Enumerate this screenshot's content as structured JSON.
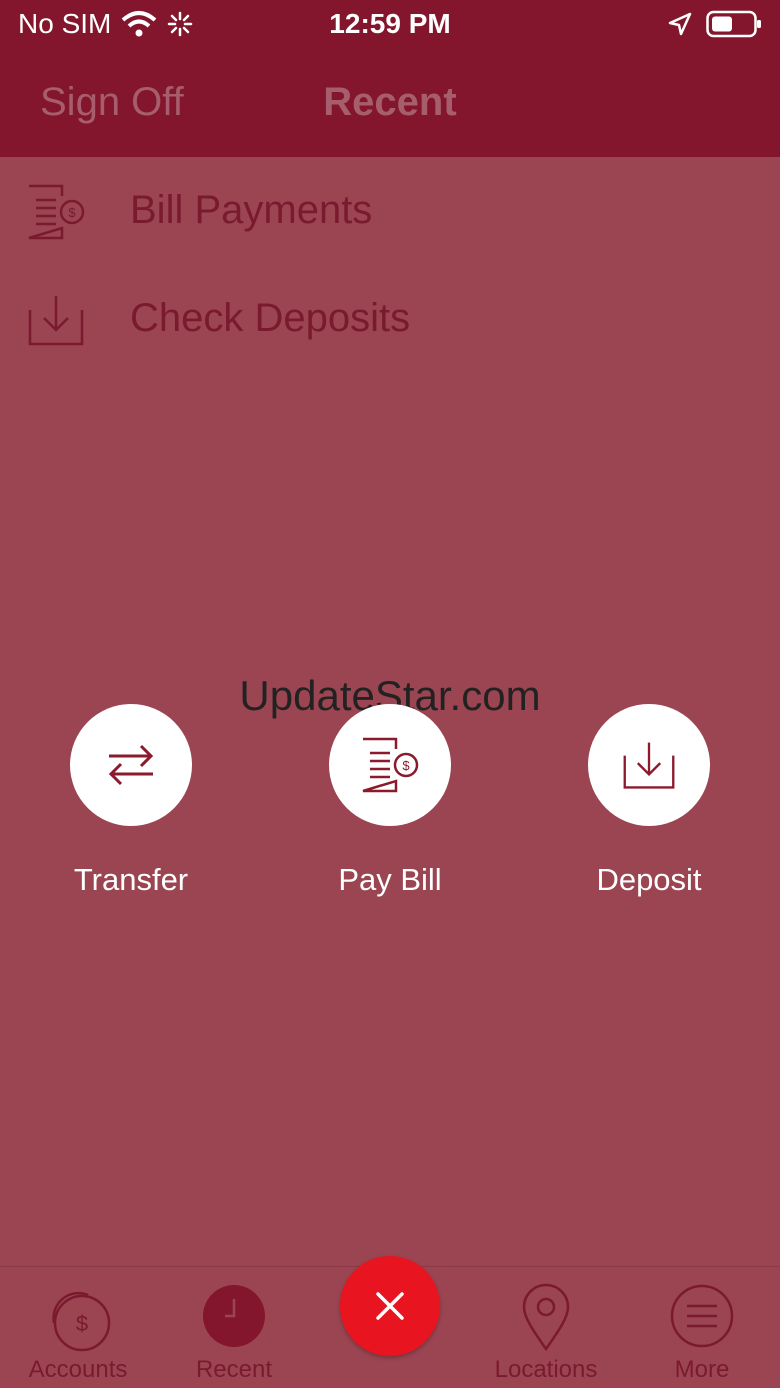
{
  "status_bar": {
    "carrier": "No SIM",
    "time": "12:59 PM"
  },
  "navbar": {
    "sign_off": "Sign Off",
    "title": "Recent"
  },
  "recent_list": [
    {
      "label": "Bill Payments",
      "icon": "bill-icon"
    },
    {
      "label": "Check Deposits",
      "icon": "deposit-icon"
    }
  ],
  "watermark": "UpdateStar.com",
  "quick_actions": [
    {
      "label": "Transfer",
      "icon": "transfer-icon"
    },
    {
      "label": "Pay Bill",
      "icon": "bill-icon"
    },
    {
      "label": "Deposit",
      "icon": "deposit-icon"
    }
  ],
  "tabbar": {
    "accounts": "Accounts",
    "recent": "Recent",
    "locations": "Locations",
    "more": "More"
  },
  "colors": {
    "brand": "#83162c",
    "overlay": "#9b4552",
    "close": "#e8141f"
  }
}
